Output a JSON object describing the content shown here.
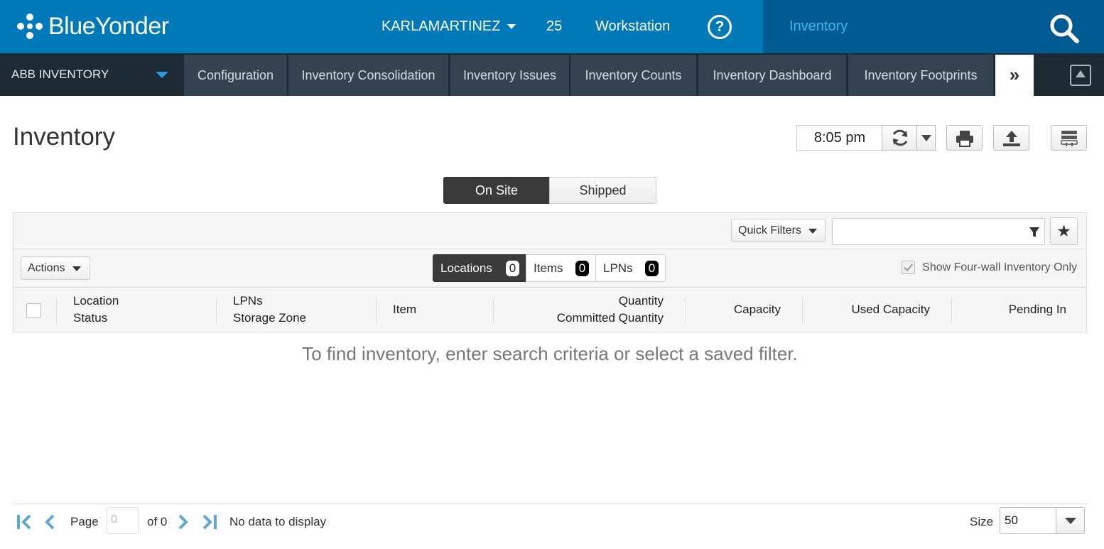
{
  "header": {
    "brand": "BlueYonder",
    "user": "KARLAMARTINEZ",
    "warehouse_count": "25",
    "workstation": "Workstation",
    "help_glyph": "?",
    "module": "Inventory",
    "colors": {
      "topbar": "#0079b8",
      "topbar_right": "#005b93",
      "module_text": "#41b6e6",
      "nav_bg": "#1e2a33"
    }
  },
  "nav": {
    "app": "ABB INVENTORY",
    "tabs": [
      {
        "label": "Configuration"
      },
      {
        "label": "Inventory Consolidation"
      },
      {
        "label": "Inventory Issues"
      },
      {
        "label": "Inventory Counts"
      },
      {
        "label": "Inventory Dashboard"
      },
      {
        "label": "Inventory Footprints"
      }
    ],
    "more_glyph": "»"
  },
  "page": {
    "title": "Inventory",
    "time": "8:05 pm",
    "toolbar_icons": [
      "refresh-icon",
      "print-icon",
      "export-icon",
      "layout-icon"
    ]
  },
  "toggle": {
    "on": "On Site",
    "off": "Shipped",
    "selected": "On Site"
  },
  "grid": {
    "quick_filters": "Quick Filters",
    "filter_value": "",
    "actions": "Actions",
    "tabs": [
      {
        "label": "Locations",
        "count": "0"
      },
      {
        "label": "Items",
        "count": "0"
      },
      {
        "label": "LPNs",
        "count": "0"
      }
    ],
    "four_wall": "Show Four-wall Inventory Only",
    "four_wall_checked": true,
    "columns": [
      {
        "line1": "Location",
        "line2": "Status"
      },
      {
        "line1": "LPNs",
        "line2": "Storage Zone"
      },
      {
        "line1": "Item"
      },
      {
        "line1": "Quantity",
        "line2": "Committed Quantity"
      },
      {
        "line1": "Capacity"
      },
      {
        "line1": "Used Capacity"
      },
      {
        "line1": "Pending In"
      }
    ],
    "empty_message": "To find inventory, enter search criteria or select a saved filter."
  },
  "pager": {
    "page_label": "Page",
    "page_value": "0",
    "of_label": "of 0",
    "status": "No data to display",
    "size_label": "Size",
    "size_value": "50"
  }
}
